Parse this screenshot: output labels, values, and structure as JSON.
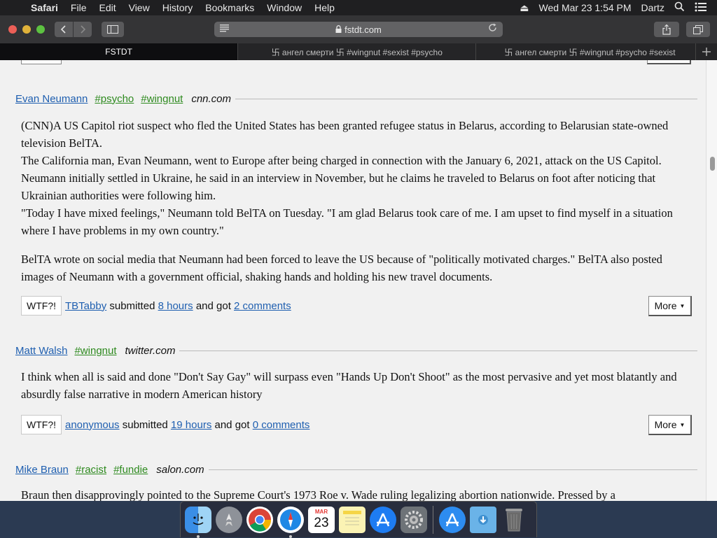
{
  "menubar": {
    "apple": "",
    "app_name": "Safari",
    "menus": [
      "File",
      "Edit",
      "View",
      "History",
      "Bookmarks",
      "Window",
      "Help"
    ],
    "eject": "⏏",
    "clock": "Wed Mar 23  1:54 PM",
    "user": "Dartz"
  },
  "toolbar": {
    "url": "fstdt.com",
    "colors": {
      "close": "#ec5f57",
      "minimize": "#e0b23a",
      "zoom": "#5dc241"
    }
  },
  "tabs": [
    "FSTDT",
    "卐 ангел смерти 卐 #wingnut #sexist #psycho",
    "卐 ангел смерти 卐 #wingnut #psycho #sexist"
  ],
  "posts": [
    {
      "author": "Evan Neumann",
      "tags": [
        "#psycho",
        "#wingnut"
      ],
      "source": "cnn.com",
      "paragraphs": [
        "(CNN)A US Capitol riot suspect who fled the United States has been granted refugee status in Belarus, according to Belarusian state-owned television BelTA.",
        "The California man, Evan Neumann, went to Europe after being charged in connection with the January 6, 2021, attack on the US Capitol. Neumann initially settled in Ukraine, he said in an interview in November, but he claims he traveled to Belarus on foot after noticing that Ukrainian authorities were following him.",
        "\"Today I have mixed feelings,\" Neumann told BelTA on Tuesday. \"I am glad Belarus took care of me. I am upset to find myself in a situation where I have problems in my own country.\"",
        "BelTA wrote on social media that Neumann had been forced to leave the US because of \"politically motivated charges.\" BelTA also posted images of Neumann with a government official, shaking hands and holding his new travel documents."
      ],
      "wtf_label": "WTF?!",
      "submitter": "TBTabby",
      "submitted_text": "submitted",
      "time": "8 hours",
      "and_got": "and got",
      "comments": "2 comments",
      "more_label": "More"
    },
    {
      "author": "Matt Walsh",
      "tags": [
        "#wingnut"
      ],
      "source": "twitter.com",
      "paragraphs": [
        "I think when all is said and done \"Don't Say Gay\" will surpass even \"Hands Up Don't Shoot\" as the most pervasive and yet most blatantly and absurdly false narrative in modern American history"
      ],
      "wtf_label": "WTF?!",
      "submitter": "anonymous",
      "submitted_text": "submitted",
      "time": "19 hours",
      "and_got": "and got",
      "comments": "0 comments",
      "more_label": "More"
    },
    {
      "author": "Mike Braun",
      "tags": [
        "#racist",
        "#fundie"
      ],
      "source": "salon.com",
      "paragraphs": [
        "Braun then disapprovingly pointed to the Supreme Court's 1973 Roe v. Wade ruling legalizing abortion nationwide. Pressed by a"
      ]
    }
  ],
  "dock": {
    "calendar_month": "MAR",
    "calendar_day": "23"
  }
}
